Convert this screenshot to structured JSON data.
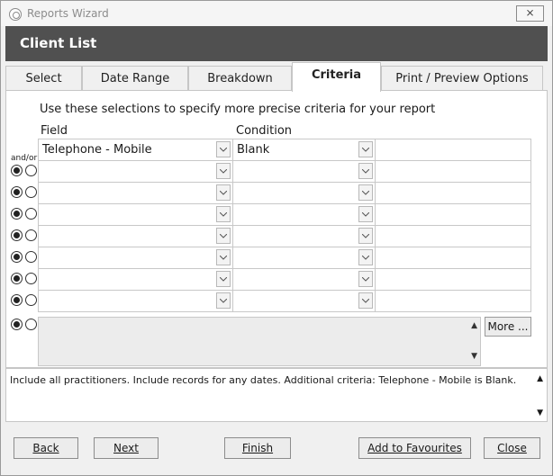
{
  "window": {
    "title": "Reports Wizard",
    "close_label": "⨯"
  },
  "header": {
    "title": "Client List"
  },
  "tabs": [
    {
      "label": "Select"
    },
    {
      "label": "Date Range"
    },
    {
      "label": "Breakdown"
    },
    {
      "label": "Criteria",
      "active": true
    },
    {
      "label": "Print / Preview Options"
    }
  ],
  "criteria": {
    "intro": "Use these selections to specify more precise criteria for your report",
    "field_header": "Field",
    "condition_header": "Condition",
    "andor_label": "and/or",
    "rows": [
      {
        "field": "Telephone - Mobile",
        "condition": "Blank",
        "value": ""
      },
      {
        "field": "",
        "condition": "",
        "value": ""
      },
      {
        "field": "",
        "condition": "",
        "value": ""
      },
      {
        "field": "",
        "condition": "",
        "value": ""
      },
      {
        "field": "",
        "condition": "",
        "value": ""
      },
      {
        "field": "",
        "condition": "",
        "value": ""
      },
      {
        "field": "",
        "condition": "",
        "value": ""
      },
      {
        "field": "",
        "condition": "",
        "value": ""
      }
    ],
    "more_label": "More ..."
  },
  "summary": {
    "text": "Include all practitioners. Include records for any dates. Additional criteria: Telephone - Mobile is Blank."
  },
  "buttons": {
    "back": "Back",
    "next": "Next",
    "finish": "Finish",
    "favourites": "Add to Favourites",
    "close": "Close"
  }
}
